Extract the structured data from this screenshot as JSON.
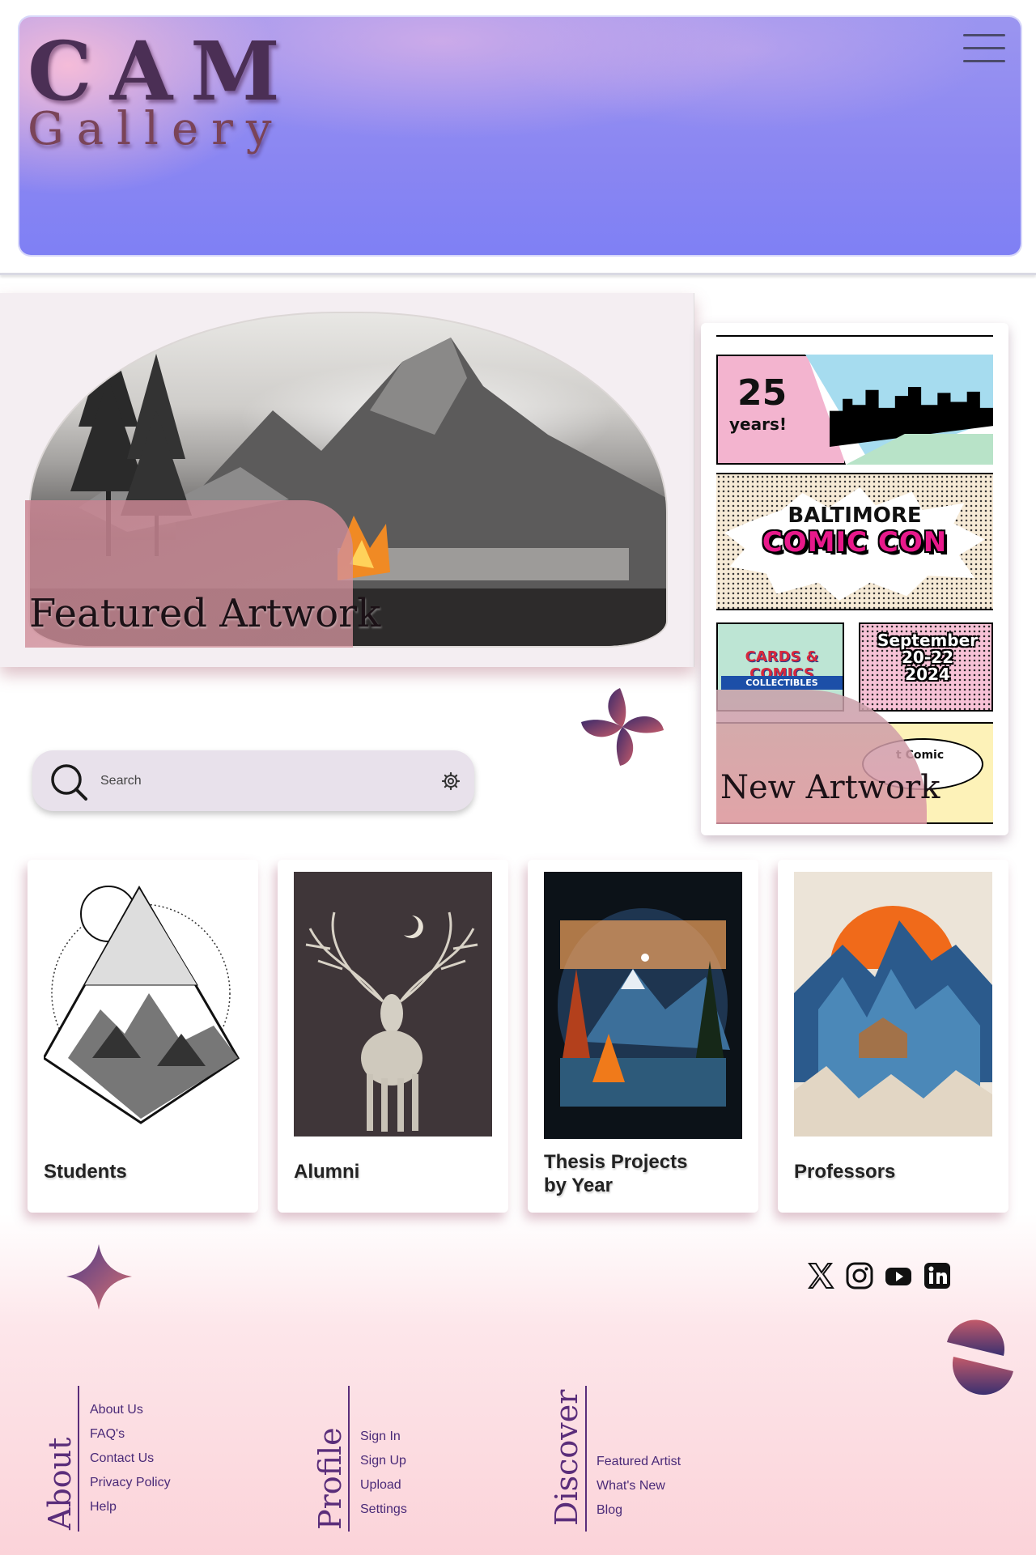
{
  "header": {
    "logo_line1": "CAM",
    "logo_line2": "Gallery",
    "menu_icon": "hamburger-menu-icon"
  },
  "featured": {
    "caption": "Featured Artwork"
  },
  "new_artwork": {
    "caption": "New Artwork",
    "poster": {
      "years_number": "25",
      "years_label": "years!",
      "title_line1": "BALTIMORE",
      "title_line2": "COMIC CON",
      "sponsor": "CARDS & COMICS",
      "sponsor_sub": "COLLECTIBLES",
      "date_line1": "September",
      "date_line2": "20-22",
      "date_line3": "2024",
      "bubble_text": "t Comic"
    }
  },
  "search": {
    "placeholder": "Search",
    "icon": "search-icon",
    "settings_icon": "gear-icon"
  },
  "categories": [
    {
      "label": "Students"
    },
    {
      "label": "Alumni"
    },
    {
      "label_line1": "Thesis Projects",
      "label_line2": "by Year"
    },
    {
      "label": "Professors"
    }
  ],
  "social": [
    "x-icon",
    "instagram-icon",
    "youtube-icon",
    "linkedin-icon"
  ],
  "footer": {
    "about": {
      "heading": "About",
      "links": [
        "About Us",
        "FAQ's",
        "Contact Us",
        "Privacy Policy",
        "Help"
      ]
    },
    "profile": {
      "heading": "Profile",
      "links": [
        "Sign In",
        "Sign Up",
        "Upload",
        "Settings"
      ]
    },
    "discover": {
      "heading": "Discover",
      "links": [
        "Featured Artist",
        "What's New",
        "Blog"
      ]
    }
  },
  "colors": {
    "header_gradient_start": "#f5bcd6",
    "header_gradient_end": "#7f80f4",
    "logo": "#4b2f55",
    "footer_text": "#4a2a78",
    "footer_bg": "#fbd3d9"
  }
}
